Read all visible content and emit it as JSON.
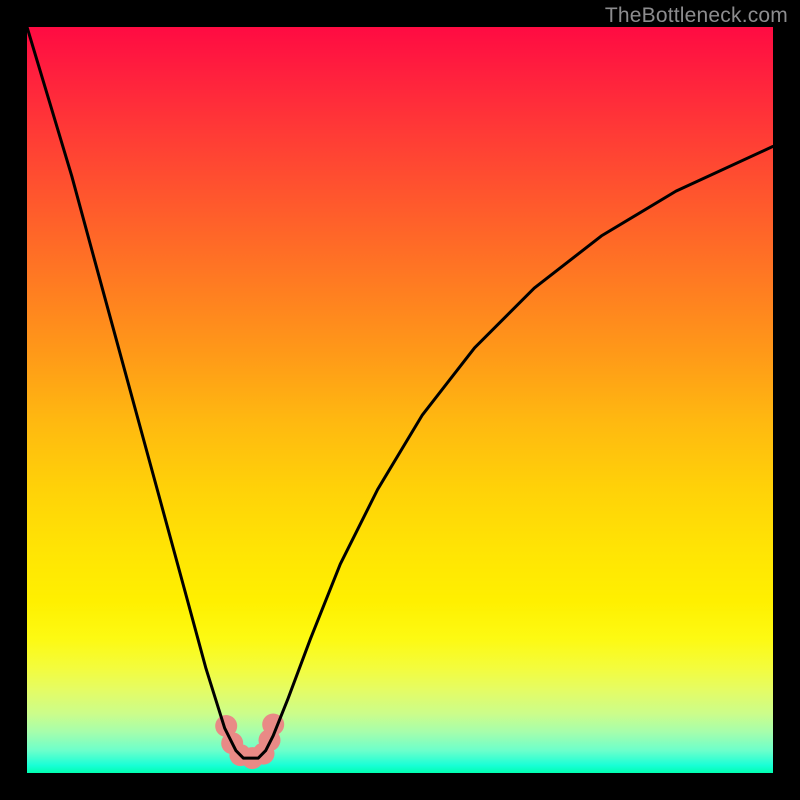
{
  "watermark": "TheBottleneck.com",
  "chart_data": {
    "type": "line",
    "title": "",
    "xlabel": "",
    "ylabel": "",
    "xlim": [
      0,
      100
    ],
    "ylim": [
      0,
      100
    ],
    "grid": false,
    "legend": false,
    "annotations": [],
    "series": [
      {
        "name": "bottleneck-curve",
        "x": [
          0,
          3,
          6,
          9,
          12,
          15,
          18,
          21,
          24,
          26.5,
          28,
          29,
          30,
          31,
          32,
          33,
          35,
          38,
          42,
          47,
          53,
          60,
          68,
          77,
          87,
          100
        ],
        "y": [
          100,
          90,
          80,
          69,
          58,
          47,
          36,
          25,
          14,
          6,
          3,
          2,
          2,
          2,
          3,
          5,
          10,
          18,
          28,
          38,
          48,
          57,
          65,
          72,
          78,
          84
        ]
      }
    ],
    "markers": [
      {
        "name": "notch-point",
        "x": 26.7,
        "y": 6.3
      },
      {
        "name": "notch-point",
        "x": 27.5,
        "y": 4.0
      },
      {
        "name": "notch-point",
        "x": 28.6,
        "y": 2.4
      },
      {
        "name": "notch-point",
        "x": 30.2,
        "y": 2.0
      },
      {
        "name": "notch-point",
        "x": 31.7,
        "y": 2.6
      },
      {
        "name": "notch-point",
        "x": 32.5,
        "y": 4.4
      },
      {
        "name": "notch-point",
        "x": 33.0,
        "y": 6.5
      }
    ],
    "gradient_stops": [
      {
        "pos": 0,
        "color": "#ff0b42"
      },
      {
        "pos": 0.5,
        "color": "#ffb910"
      },
      {
        "pos": 0.78,
        "color": "#fff000"
      },
      {
        "pos": 1.0,
        "color": "#00ffb0"
      }
    ]
  }
}
